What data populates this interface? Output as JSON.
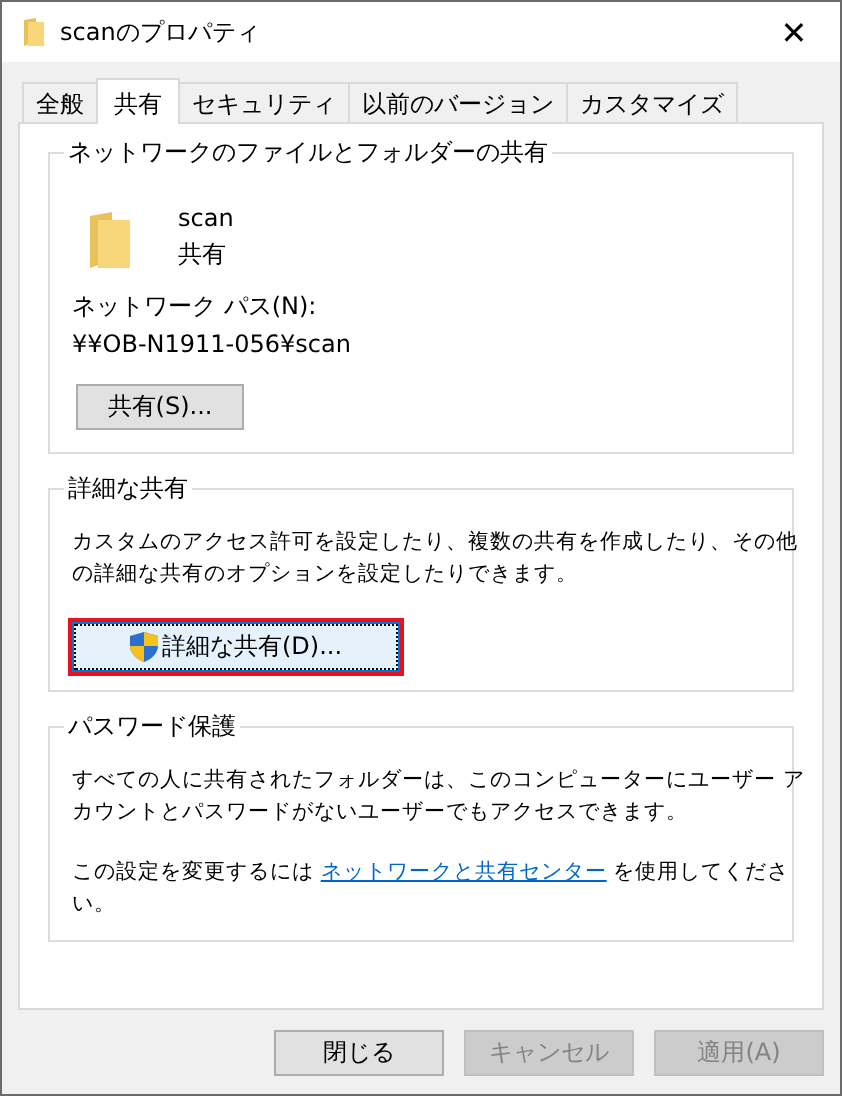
{
  "window": {
    "title": "scanのプロパティ",
    "close": "✕"
  },
  "tabs": [
    {
      "label": "全般",
      "selected": false
    },
    {
      "label": "共有",
      "selected": true
    },
    {
      "label": "セキュリティ",
      "selected": false
    },
    {
      "label": "以前のバージョン",
      "selected": false
    },
    {
      "label": "カスタマイズ",
      "selected": false
    }
  ],
  "groups": [
    {
      "kind": "network",
      "title": "ネットワークのファイルとフォルダーの共有",
      "folder_name": "scan",
      "folder_status": "共有",
      "path_label": "ネットワーク パス(N):",
      "path": "¥¥OB-N1911-056¥scan",
      "button": {
        "label": "共有(S)...",
        "highlighted": false
      }
    },
    {
      "kind": "advanced",
      "title": "詳細な共有",
      "description": "カスタムのアクセス許可を設定したり、複数の共有を作成したり、その他の詳細な共有のオプションを設定したりできます。",
      "button": {
        "label": "詳細な共有(D)...",
        "highlighted": true
      }
    },
    {
      "kind": "password",
      "title": "パスワード保護",
      "description": "すべての人に共有されたフォルダーは、このコンピューターにユーザー アカウントとパスワードがないユーザーでもアクセスできます。",
      "note_before": "この設定を変更するには",
      "link": "ネットワークと共有センター",
      "note_after": "を使用してください。"
    }
  ],
  "buttons": [
    {
      "label": "閉じる",
      "disabled": false
    },
    {
      "label": "キャンセル",
      "disabled": true
    },
    {
      "label": "適用(A)",
      "disabled": true
    }
  ]
}
